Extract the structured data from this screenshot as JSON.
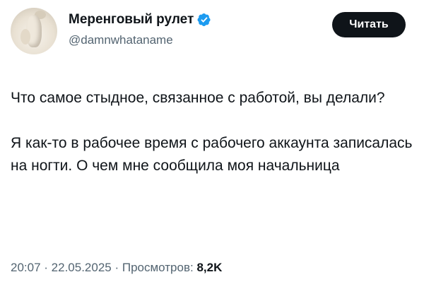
{
  "author": {
    "display_name": "Меренговый рулет",
    "handle": "@damnwhataname",
    "verified": true,
    "verified_color": "#1d9bf0",
    "avatar_icon": "avatar-image"
  },
  "follow_button": {
    "label": "Читать",
    "bg": "#0f1419",
    "fg": "#ffffff"
  },
  "tweet": {
    "paragraph_1": "Что самое стыдное, связанное с работой, вы делали?",
    "paragraph_2": "Я как-то в рабочее время с рабочего аккаунта записалась на ногти. О чем мне сообщила моя начальница"
  },
  "meta": {
    "time": "20:07",
    "sep_1": " · ",
    "date": "22.05.2025",
    "sep_2": " · ",
    "views_label": "Просмотров: ",
    "views_count": "8,2K"
  }
}
